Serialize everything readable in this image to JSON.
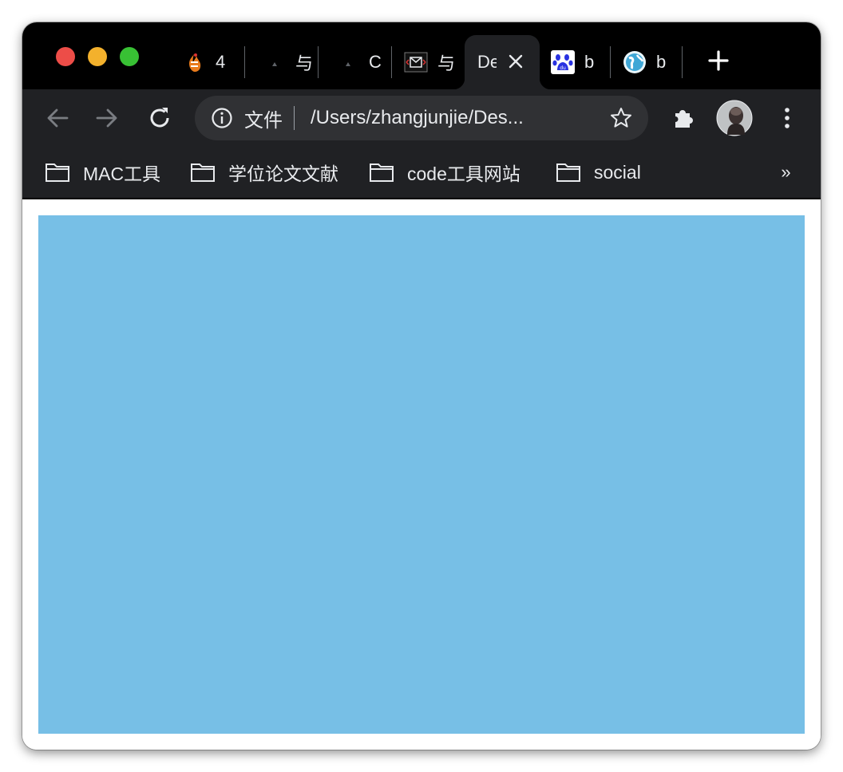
{
  "window": {
    "traffic_lights": {
      "close_color": "#ed4d48",
      "minimize_color": "#f3b12c",
      "zoom_color": "#38c134"
    }
  },
  "tabs": [
    {
      "title": "4",
      "icon": "flame-icon",
      "active": false
    },
    {
      "title": "与",
      "icon": "triangle-icon",
      "active": false
    },
    {
      "title": "C",
      "icon": "triangle-icon",
      "active": false
    },
    {
      "title": "与",
      "icon": "mail-icon",
      "active": false
    },
    {
      "title": "De",
      "icon": "",
      "active": true
    },
    {
      "title": "b",
      "icon": "baidu-paw-icon",
      "active": false
    },
    {
      "title": "b",
      "icon": "globe-icon",
      "active": false
    }
  ],
  "new_tab_label": "+",
  "toolbar": {
    "back_icon": "back-arrow-icon",
    "forward_icon": "forward-arrow-icon",
    "reload_icon": "reload-icon",
    "extensions_icon": "puzzle-icon",
    "menu_icon": "kebab-menu-icon"
  },
  "omnibox": {
    "chip_label": "文件",
    "url": "/Users/zhangjunjie/Des..."
  },
  "bookmarks": [
    {
      "label": "MAC工具"
    },
    {
      "label": "学位论文文献"
    },
    {
      "label": "code工具网站"
    },
    {
      "label": "social"
    }
  ],
  "bookmarks_overflow": "»",
  "content": {
    "box_color": "#77bfe6"
  }
}
